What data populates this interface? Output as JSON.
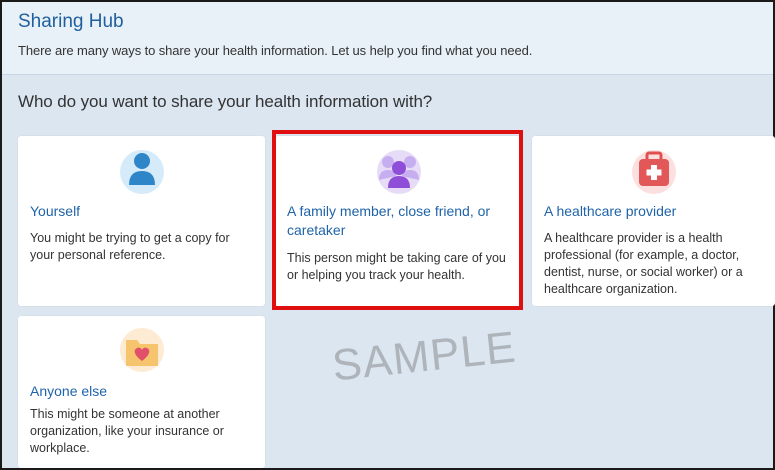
{
  "header": {
    "title": "Sharing Hub",
    "description": "There are many ways to share your health information. Let us help you find what you need."
  },
  "question": "Who do you want to share your health information with?",
  "cards": [
    {
      "title": "Yourself",
      "description": "You might be trying to get a copy for your personal reference.",
      "icon": "person-icon"
    },
    {
      "title": "A family member, close friend, or caretaker",
      "description": "This person might be taking care of you or helping you track your health.",
      "icon": "group-icon"
    },
    {
      "title": "A healthcare provider",
      "description": "A healthcare provider is a health professional (for example, a doctor, dentist, nurse, or social worker) or a healthcare organization.",
      "icon": "medical-bag-icon"
    },
    {
      "title": "Anyone else",
      "description": "This might be someone at another organization, like your insurance or workplace.",
      "icon": "heart-folder-icon"
    }
  ],
  "watermark": "SAMPLE",
  "colors": {
    "accent": "#1f63a8",
    "highlight": "#e01010",
    "background": "#dbe6f1"
  }
}
